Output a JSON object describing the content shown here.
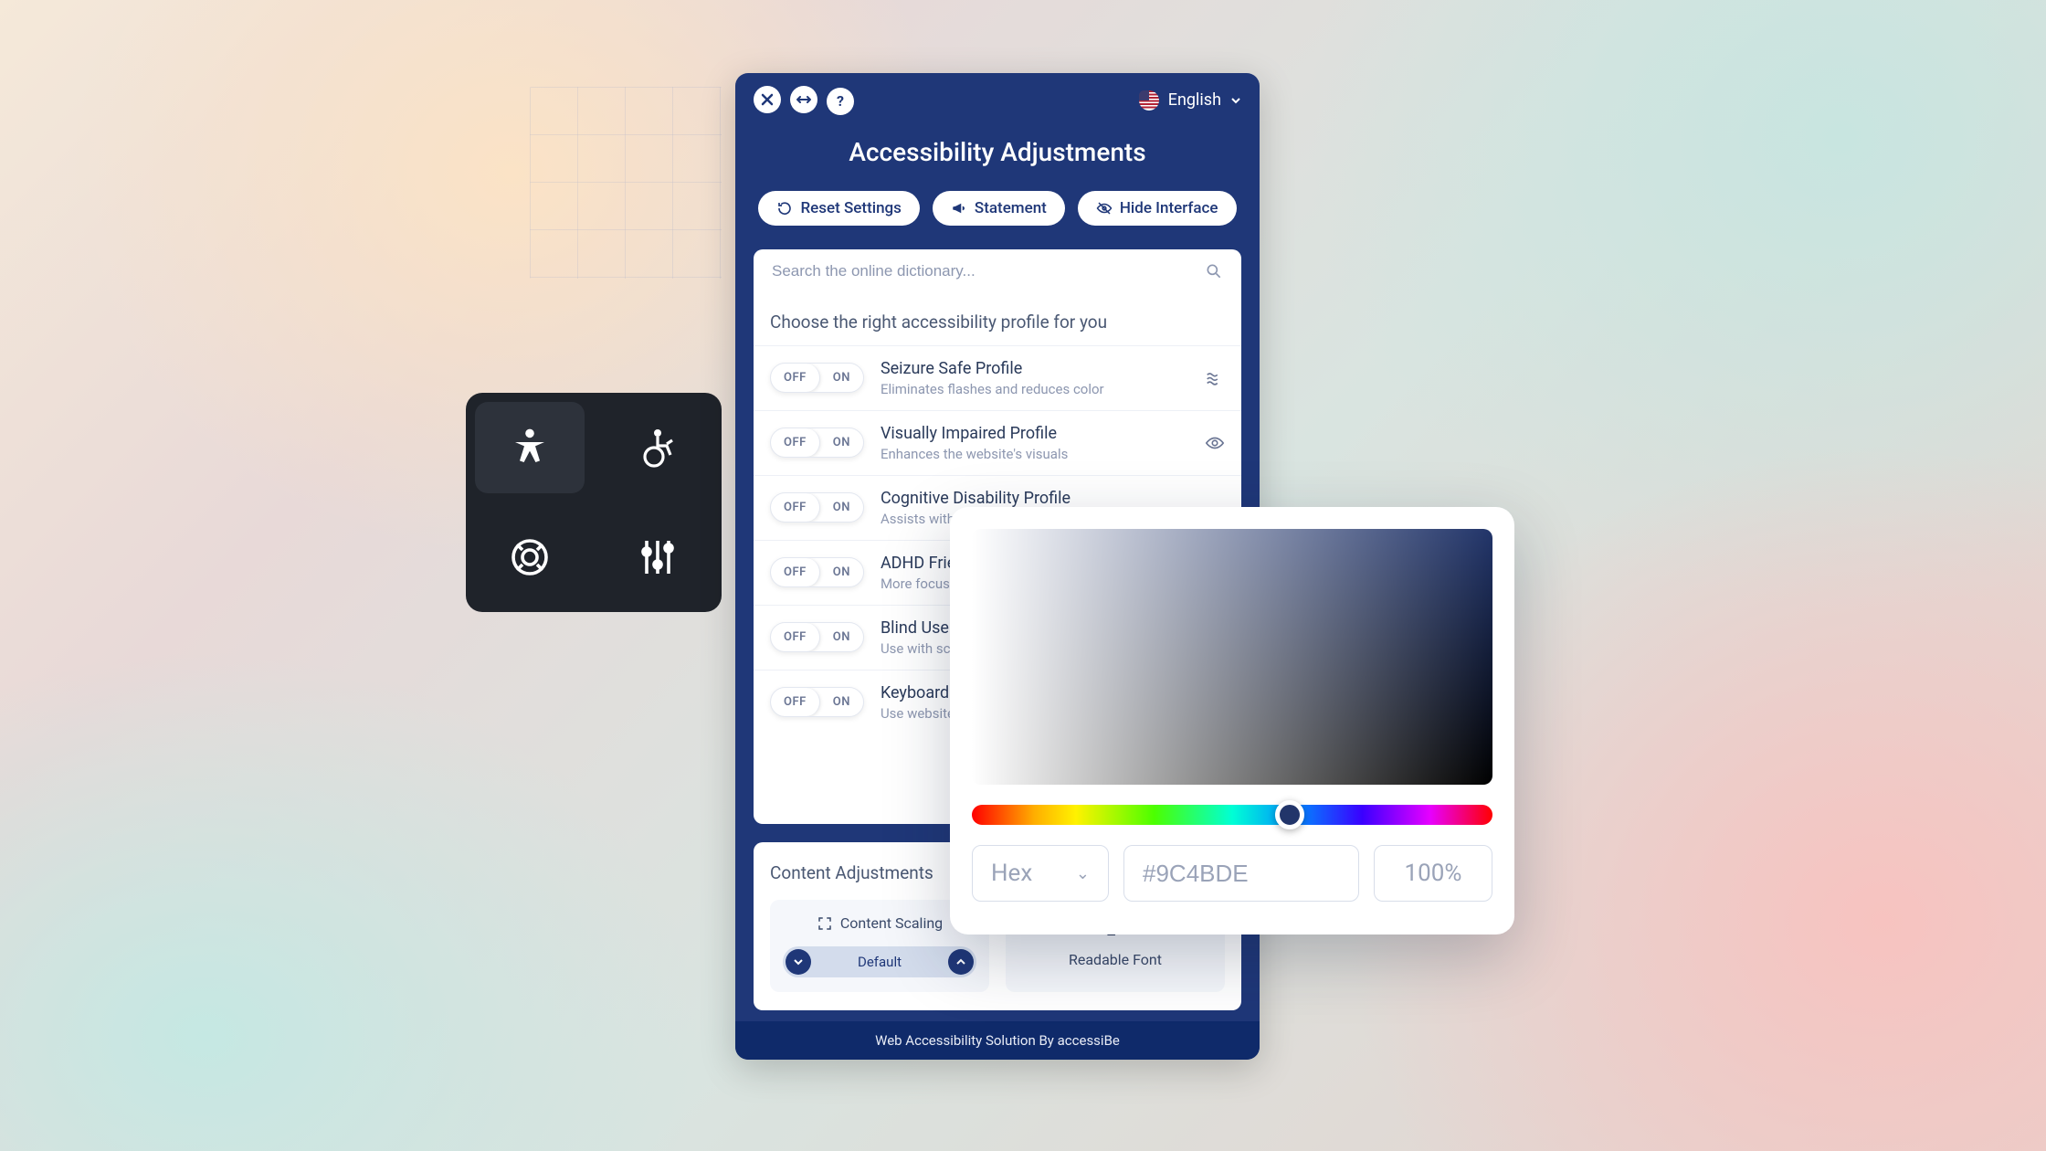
{
  "language": {
    "label": "English"
  },
  "panel": {
    "title": "Accessibility Adjustments",
    "actions": {
      "reset": "Reset Settings",
      "statement": "Statement",
      "hide": "Hide Interface"
    },
    "search_placeholder": "Search the online dictionary...",
    "profiles_heading": "Choose the right accessibility profile for you",
    "toggle": {
      "off": "OFF",
      "on": "ON"
    },
    "profiles": [
      {
        "name": "Seizure Safe Profile",
        "desc": "Eliminates flashes and reduces color"
      },
      {
        "name": "Visually Impaired Profile",
        "desc": "Enhances the website's visuals"
      },
      {
        "name": "Cognitive Disability Profile",
        "desc": "Assists with reading and focusing"
      },
      {
        "name": "ADHD Friendly Profile",
        "desc": "More focus and fewer distractions"
      },
      {
        "name": "Blind Users (Screen Reader)",
        "desc": "Use with screen-readers"
      },
      {
        "name": "Keyboard Navigation (Motor)",
        "desc": "Use website with the keyboard"
      }
    ],
    "content_adjustments": {
      "title": "Content Adjustments",
      "scaling": {
        "label": "Content Scaling",
        "value": "Default"
      },
      "readable_font": {
        "label": "Readable Font"
      }
    },
    "footer": "Web Accessibility Solution By accessiBe"
  },
  "color_picker": {
    "format_label": "Hex",
    "hex_value": "#9C4BDE",
    "alpha_value": "100%",
    "hue_thumb_color": "#22356a"
  }
}
